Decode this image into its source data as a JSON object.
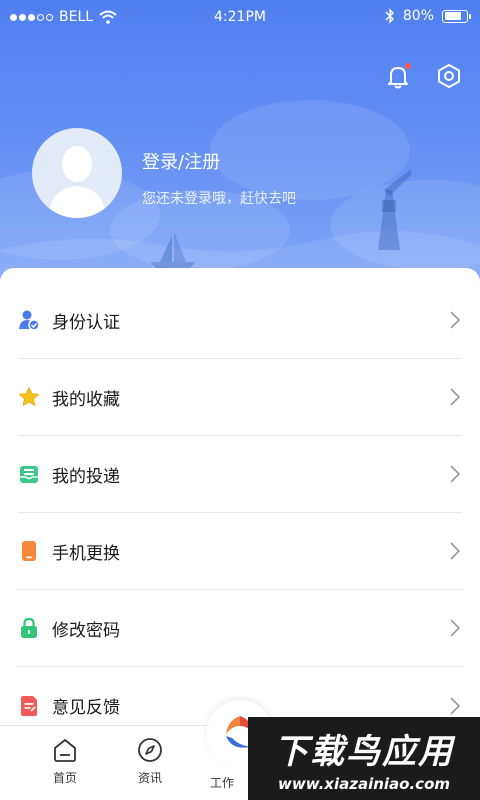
{
  "status_bar": {
    "carrier": "BELL",
    "time": "4:21PM",
    "battery": "80%",
    "battery_level": 0.8
  },
  "header": {
    "login_title": "登录/注册",
    "login_subtitle": "您还未登录哦，赶快去吧",
    "notification_badge": true
  },
  "menu": {
    "items": [
      {
        "label": "身份认证",
        "icon": "id-verify-icon"
      },
      {
        "label": "我的收藏",
        "icon": "star-icon"
      },
      {
        "label": "我的投递",
        "icon": "inbox-icon"
      },
      {
        "label": "手机更换",
        "icon": "phone-icon"
      },
      {
        "label": "修改密码",
        "icon": "lock-icon"
      },
      {
        "label": "意见反馈",
        "icon": "feedback-icon"
      }
    ]
  },
  "tabbar": {
    "tabs": [
      {
        "label": "首页",
        "icon": "home-icon"
      },
      {
        "label": "资讯",
        "icon": "compass-icon"
      },
      {
        "label": "工作",
        "icon": "work-icon"
      }
    ]
  },
  "watermark": {
    "main": "下载鸟应用",
    "sub": "www.xiazainiao.com"
  },
  "colors": {
    "header_blue": "#4f7ff0",
    "badge_red": "#ff5a4f",
    "star_yellow": "#f7c21c",
    "inbox_green": "#3dc88a",
    "phone_orange": "#f5883a",
    "lock_green": "#34c47a",
    "feedback_red": "#f25a5a"
  }
}
